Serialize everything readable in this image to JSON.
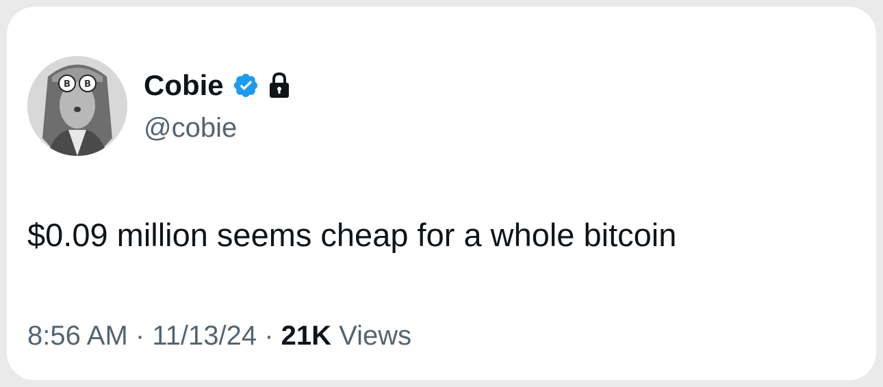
{
  "tweet": {
    "author": {
      "display_name": "Cobie",
      "handle": "@cobie",
      "verified_icon": "verified-badge-icon",
      "protected_icon": "lock-icon",
      "avatar": "avatar"
    },
    "text": "$0.09 million seems cheap for a whole bitcoin",
    "meta": {
      "time": "8:56 AM",
      "separator": "·",
      "date": "11/13/24",
      "views_count": "21K",
      "views_label": "Views"
    }
  },
  "colors": {
    "primary_text": "#0f1419",
    "secondary_text": "#536471",
    "verified_blue": "#1d9bf0",
    "background": "#ffffff"
  }
}
